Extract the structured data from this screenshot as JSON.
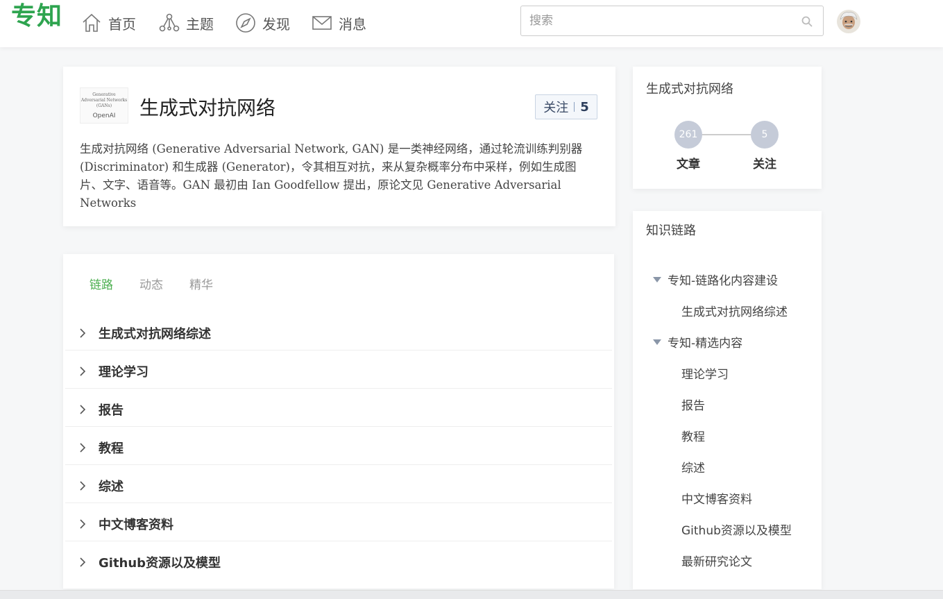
{
  "header": {
    "logo": "专知",
    "nav": [
      {
        "label": "首页",
        "icon": "home-icon"
      },
      {
        "label": "主题",
        "icon": "topic-graph-icon"
      },
      {
        "label": "发现",
        "icon": "compass-icon"
      },
      {
        "label": "消息",
        "icon": "mail-icon"
      }
    ],
    "search_placeholder": "搜索"
  },
  "topic": {
    "thumb_text": "Generative Adversarial Networks (GANs)",
    "thumb_brand": "OpenAI",
    "title": "生成式对抗网络",
    "follow_label": "关注",
    "follow_count": "5",
    "description": "生成对抗网络 (Generative Adversarial Network, GAN) 是一类神经网络，通过轮流训练判别器 (Discriminator) 和生成器 (Generator)，令其相互对抗，来从复杂概率分布中采样，例如生成图片、文字、语音等。GAN 最初由 Ian Goodfellow 提出，原论文见 Generative Adversarial Networks"
  },
  "tabs": [
    {
      "label": "链路",
      "active": true
    },
    {
      "label": "动态",
      "active": false
    },
    {
      "label": "精华",
      "active": false
    }
  ],
  "chain_items": [
    "生成式对抗网络综述",
    "理论学习",
    "报告",
    "教程",
    "综述",
    "中文博客资料",
    "Github资源以及模型"
  ],
  "stats": {
    "title": "生成式对抗网络",
    "articles_count": "261",
    "articles_label": "文章",
    "follows_count": "5",
    "follows_label": "关注"
  },
  "knowledge_tree": {
    "title": "知识链路",
    "groups": [
      {
        "label": "专知-链路化内容建设",
        "children": [
          "生成式对抗网络综述"
        ]
      },
      {
        "label": "专知-精选内容",
        "children": [
          "理论学习",
          "报告",
          "教程",
          "综述",
          "中文博客资料",
          "Github资源以及模型",
          "最新研究论文"
        ]
      }
    ]
  },
  "colors": {
    "brand": "#2ea44f",
    "active_tab": "#4caf50",
    "stat_circle": "#c5cbd8"
  }
}
